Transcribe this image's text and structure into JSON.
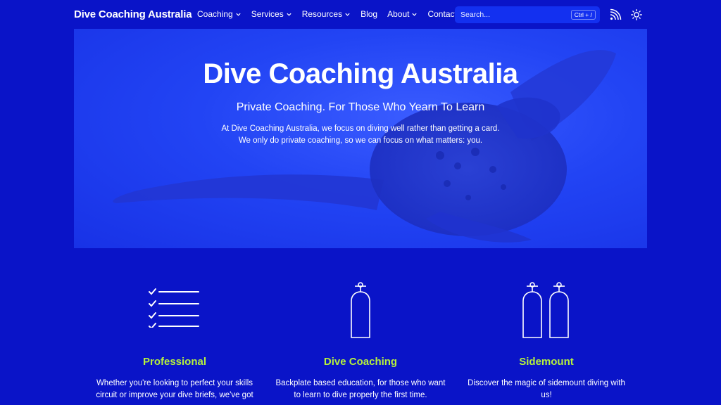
{
  "nav": {
    "brand": "Dive Coaching Australia",
    "items": [
      {
        "label": "Coaching",
        "dropdown": true
      },
      {
        "label": "Services",
        "dropdown": true
      },
      {
        "label": "Resources",
        "dropdown": true
      },
      {
        "label": "Blog",
        "dropdown": false
      },
      {
        "label": "About",
        "dropdown": true
      },
      {
        "label": "Contact",
        "dropdown": false
      }
    ],
    "search_placeholder": "Search...",
    "search_shortcut": "Ctrl + /",
    "icons": {
      "rss": "rss-icon",
      "theme": "sun-icon"
    }
  },
  "hero": {
    "title": "Dive Coaching Australia",
    "subtitle": "Private Coaching. For Those Who Yearn To Learn",
    "line1": "At Dive Coaching Australia, we focus on diving well rather than getting a card.",
    "line2": "We only do private coaching, so we can focus on what matters: you."
  },
  "features": [
    {
      "title": "Professional",
      "line1": "Whether you're looking to perfect your skills",
      "line2": "circuit or improve your dive briefs, we've got",
      "icon": "checklist-icon"
    },
    {
      "title": "Dive Coaching",
      "line1": "Backplate based education, for those who want",
      "line2": "to learn to dive properly the first time.",
      "icon": "single-tank-icon"
    },
    {
      "title": "Sidemount",
      "line1": "Discover the magic of sidemount diving with",
      "line2": "us!",
      "icon": "twin-tanks-icon"
    }
  ],
  "colors": {
    "background": "#0a14c8",
    "accent": "#b6f23c",
    "search_bg": "#1330f0"
  }
}
